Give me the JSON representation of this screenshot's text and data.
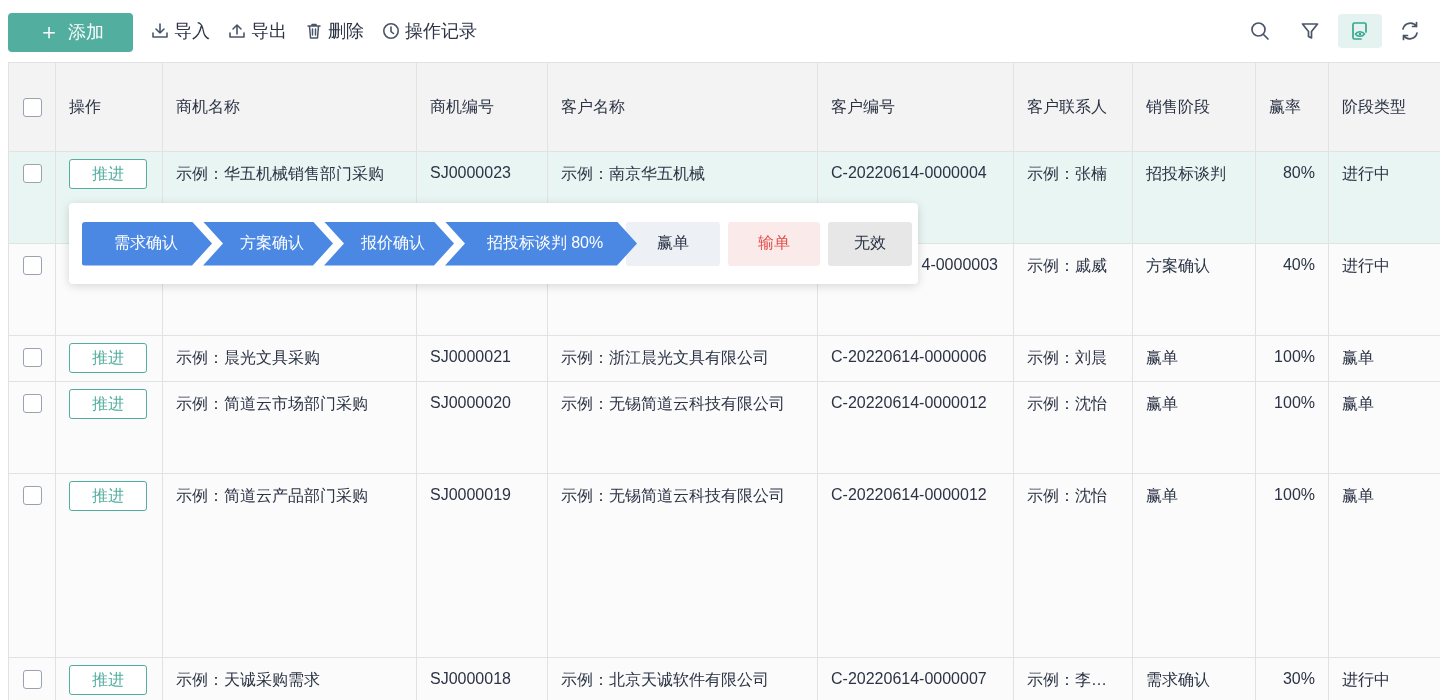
{
  "toolbar": {
    "add_button": {
      "icon": "＋",
      "label": "添加"
    },
    "actions": [
      {
        "kind": "import",
        "label": "导入"
      },
      {
        "kind": "export",
        "label": "导出"
      },
      {
        "kind": "delete",
        "label": "删除"
      },
      {
        "kind": "history",
        "label": "操作记录"
      }
    ],
    "tools": [
      {
        "kind": "search",
        "selected": false
      },
      {
        "kind": "filter",
        "selected": false
      },
      {
        "kind": "view",
        "selected": true
      },
      {
        "kind": "refresh",
        "selected": false
      }
    ]
  },
  "table": {
    "columns": [
      {
        "kind": "checkbox",
        "checked": false
      },
      {
        "kind": "text",
        "text": "操作"
      },
      {
        "kind": "text",
        "text": "商机名称"
      },
      {
        "kind": "text",
        "text": "商机编号"
      },
      {
        "kind": "text",
        "text": "客户名称"
      },
      {
        "kind": "text",
        "text": "客户编号"
      },
      {
        "kind": "text",
        "text": "客户联系人"
      },
      {
        "kind": "text",
        "text": "销售阶段"
      },
      {
        "kind": "text",
        "text": "赢率"
      },
      {
        "kind": "text",
        "text": "阶段类型"
      }
    ],
    "rows": [
      {
        "selected": true,
        "cells": [
          {
            "kind": "checkbox",
            "checked": false
          },
          {
            "kind": "button",
            "text": "推进"
          },
          {
            "kind": "text",
            "text": "示例：华五机械销售部门采购"
          },
          {
            "kind": "text",
            "text": "SJ0000023"
          },
          {
            "kind": "text",
            "text": "示例：南京华五机械"
          },
          {
            "kind": "text",
            "text": "C-20220614-0000004"
          },
          {
            "kind": "text",
            "text": "示例：张楠"
          },
          {
            "kind": "text",
            "text": "招投标谈判"
          },
          {
            "kind": "number",
            "text": "80%"
          },
          {
            "kind": "text",
            "text": "进行中"
          }
        ]
      },
      {
        "selected": false,
        "cells": [
          {
            "kind": "checkbox",
            "checked": false
          },
          {
            "kind": "covered"
          },
          {
            "kind": "covered"
          },
          {
            "kind": "covered"
          },
          {
            "kind": "covered"
          },
          {
            "kind": "cut",
            "text": "4-0000003"
          },
          {
            "kind": "text",
            "text": "示例：戚威"
          },
          {
            "kind": "text",
            "text": "方案确认"
          },
          {
            "kind": "number",
            "text": "40%"
          },
          {
            "kind": "text",
            "text": "进行中"
          }
        ]
      },
      {
        "selected": false,
        "cells": [
          {
            "kind": "checkbox",
            "checked": false
          },
          {
            "kind": "button",
            "text": "推进"
          },
          {
            "kind": "text",
            "text": "示例：晨光文具采购"
          },
          {
            "kind": "text",
            "text": "SJ0000021"
          },
          {
            "kind": "text",
            "text": "示例：浙江晨光文具有限公司"
          },
          {
            "kind": "text",
            "text": "C-20220614-0000006"
          },
          {
            "kind": "text",
            "text": "示例：刘晨"
          },
          {
            "kind": "text",
            "text": "赢单"
          },
          {
            "kind": "number",
            "text": "100%"
          },
          {
            "kind": "text",
            "text": "赢单"
          }
        ]
      },
      {
        "selected": false,
        "cells": [
          {
            "kind": "checkbox",
            "checked": false
          },
          {
            "kind": "button",
            "text": "推进"
          },
          {
            "kind": "text",
            "text": "示例：简道云市场部门采购"
          },
          {
            "kind": "text",
            "text": "SJ0000020"
          },
          {
            "kind": "text",
            "text": "示例：无锡简道云科技有限公司"
          },
          {
            "kind": "text",
            "text": "C-20220614-0000012"
          },
          {
            "kind": "text",
            "text": "示例：沈怡"
          },
          {
            "kind": "text",
            "text": "赢单"
          },
          {
            "kind": "number",
            "text": "100%"
          },
          {
            "kind": "text",
            "text": "赢单"
          }
        ]
      },
      {
        "selected": false,
        "cells": [
          {
            "kind": "checkbox",
            "checked": false
          },
          {
            "kind": "button",
            "text": "推进"
          },
          {
            "kind": "text",
            "text": "示例：简道云产品部门采购"
          },
          {
            "kind": "text",
            "text": "SJ0000019"
          },
          {
            "kind": "text",
            "text": "示例：无锡简道云科技有限公司"
          },
          {
            "kind": "text",
            "text": "C-20220614-0000012"
          },
          {
            "kind": "text",
            "text": "示例：沈怡"
          },
          {
            "kind": "text",
            "text": "赢单"
          },
          {
            "kind": "number",
            "text": "100%"
          },
          {
            "kind": "text",
            "text": "赢单"
          }
        ]
      },
      {
        "selected": false,
        "cells": [
          {
            "kind": "checkbox",
            "checked": false
          },
          {
            "kind": "button",
            "text": "推进"
          },
          {
            "kind": "text",
            "text": "示例：天诚采购需求"
          },
          {
            "kind": "text",
            "text": "SJ0000018"
          },
          {
            "kind": "text",
            "text": "示例：北京天诚软件有限公司"
          },
          {
            "kind": "text",
            "text": "C-20220614-0000007"
          },
          {
            "kind": "text",
            "text": "示例：李…"
          },
          {
            "kind": "text",
            "text": "需求确认"
          },
          {
            "kind": "number",
            "text": "30%"
          },
          {
            "kind": "text",
            "text": "进行中"
          }
        ]
      }
    ]
  },
  "stage_popup": {
    "steps": [
      {
        "label": "需求确认",
        "reached": true
      },
      {
        "label": "方案确认",
        "reached": true
      },
      {
        "label": "报价确认",
        "reached": true
      },
      {
        "label": "招投标谈判 80%",
        "reached": true
      }
    ],
    "outcomes": [
      {
        "kind": "win",
        "label": "赢单"
      },
      {
        "kind": "lose",
        "label": "输单"
      },
      {
        "kind": "invalid",
        "label": "无效"
      }
    ]
  }
}
